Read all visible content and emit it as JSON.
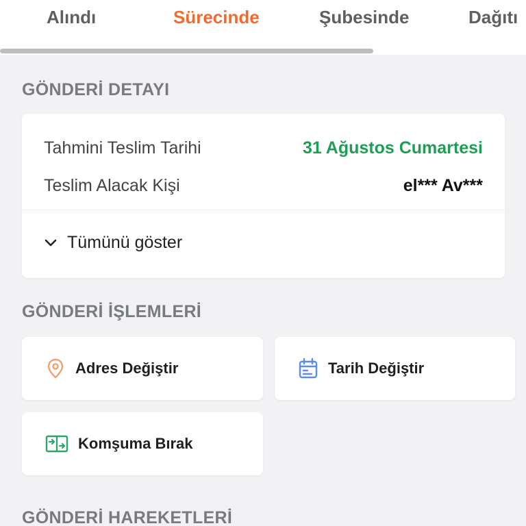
{
  "tabs": {
    "items": [
      {
        "label": "Alındı"
      },
      {
        "label": "Sürecinde"
      },
      {
        "label": "Şubesinde"
      },
      {
        "label": "Dağıtı"
      }
    ],
    "active_index": 1,
    "progress_fraction": 0.71
  },
  "sections": {
    "detail_title": "GÖNDERİ DETAYI",
    "actions_title": "GÖNDERİ İŞLEMLERİ",
    "movements_title": "GÖNDERİ HAREKETLERİ"
  },
  "detail": {
    "rows": [
      {
        "label": "Tahmini Teslim Tarihi",
        "value": "31 Ağustos Cumartesi"
      },
      {
        "label": "Teslim Alacak Kişi",
        "value": "el*** Av***"
      }
    ],
    "show_all_label": "Tümünü göster"
  },
  "actions": [
    {
      "label": "Adres Değiştir",
      "icon": "location-pin-icon",
      "color": "#f0a070"
    },
    {
      "label": "Tarih Değiştir",
      "icon": "calendar-icon",
      "color": "#5b8de8"
    },
    {
      "label": "Komşuma Bırak",
      "icon": "door-transfer-icon",
      "color": "#2ea56a"
    }
  ],
  "colors": {
    "accent_orange": "#f26a2e",
    "green": "#1e9e55",
    "background": "#f2f2f4"
  }
}
